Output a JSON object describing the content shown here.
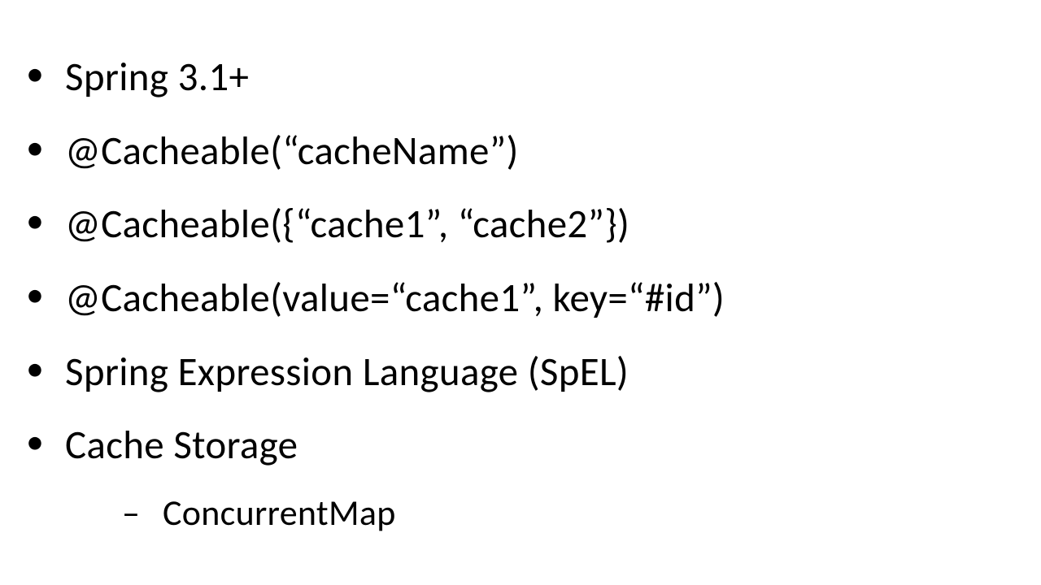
{
  "bullets": [
    "Spring 3.1+",
    "@Cacheable(“cacheName”)",
    "@Cacheable({“cache1”, “cache2”})",
    "@Cacheable(value=“cache1”, key=“#id”)",
    "Spring Expression Language (SpEL)",
    "Cache Storage"
  ],
  "subbullet": "ConcurrentMap"
}
